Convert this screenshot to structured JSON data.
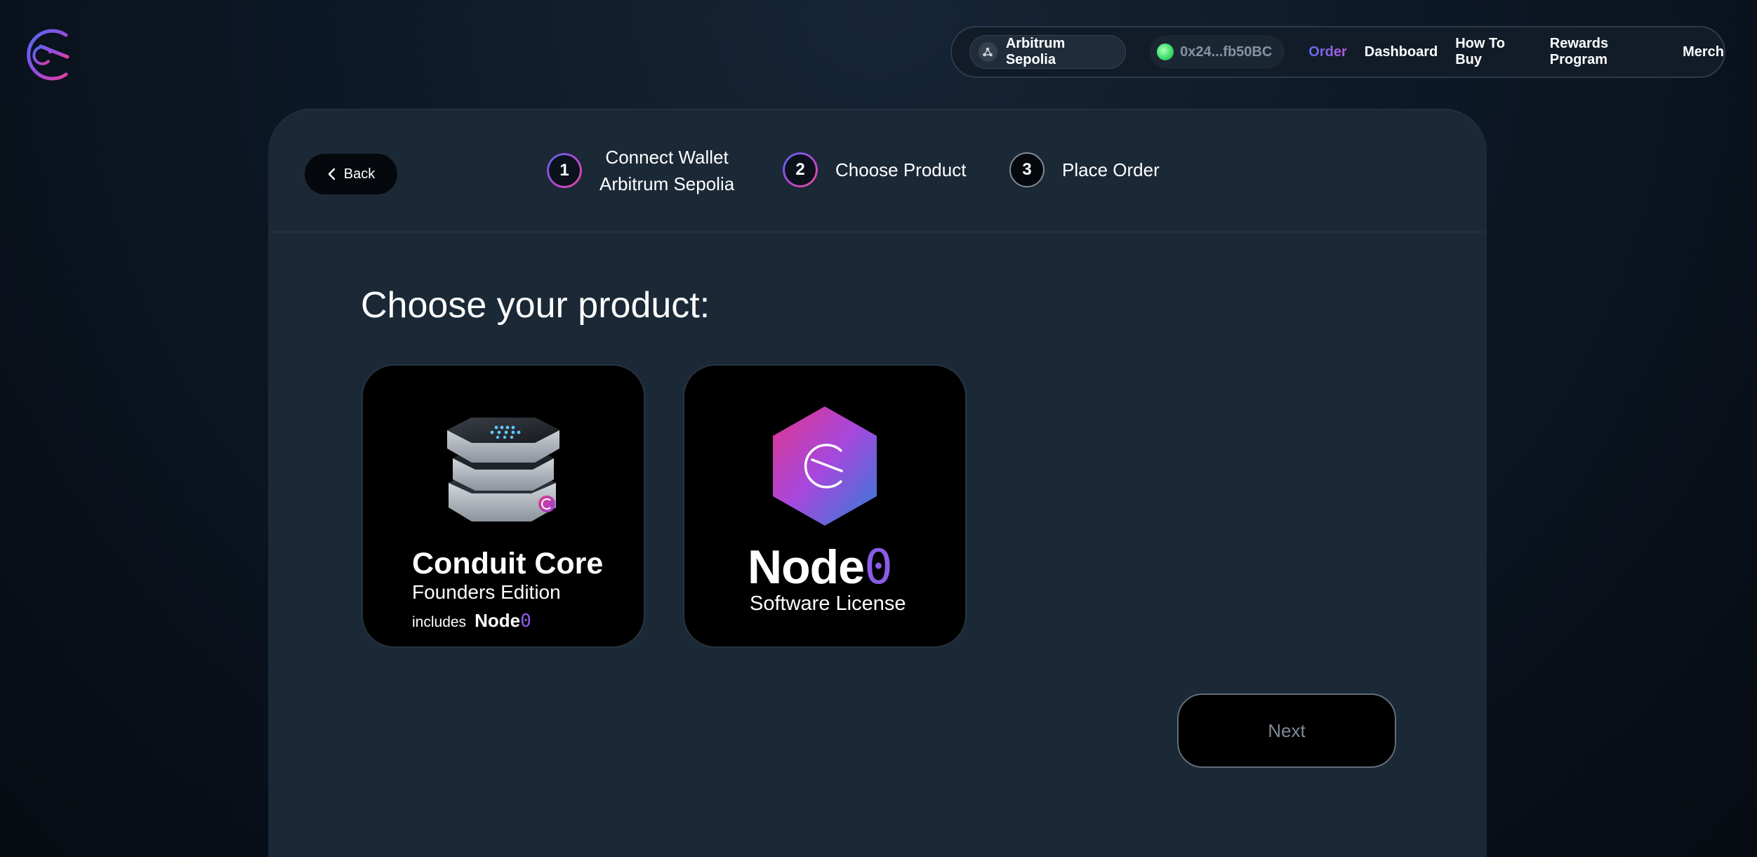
{
  "header": {
    "logo_icon": "conduit-logo-icon",
    "network_label": "Arbitrum Sepolia",
    "network_icon": "network-icon",
    "wallet_address": "0x24...fb50BC",
    "nav_links": [
      "Order",
      "Dashboard",
      "How To Buy",
      "Rewards Program",
      "Merch"
    ],
    "active_link": "Order",
    "accent_colors": [
      "#5b6cf0",
      "#b65ad6"
    ]
  },
  "stepper": {
    "back_label": "Back",
    "steps": [
      {
        "number": "1",
        "line1": "Connect Wallet",
        "line2": "Arbitrum Sepolia"
      },
      {
        "number": "2",
        "line1": "Choose Product"
      },
      {
        "number": "3",
        "line1": "Place Order"
      }
    ]
  },
  "main": {
    "heading": "Choose your product:",
    "products": [
      {
        "title": "Conduit Core",
        "subtitle": "Founders Edition",
        "includes": "includes",
        "node_word": "Node",
        "node_zero": "0",
        "image": "conduit-core-device-icon"
      },
      {
        "title_word": "Node",
        "title_zero": "0",
        "subtitle": "Software License",
        "image": "node0-hexagon-icon"
      }
    ],
    "next_label": "Next"
  }
}
